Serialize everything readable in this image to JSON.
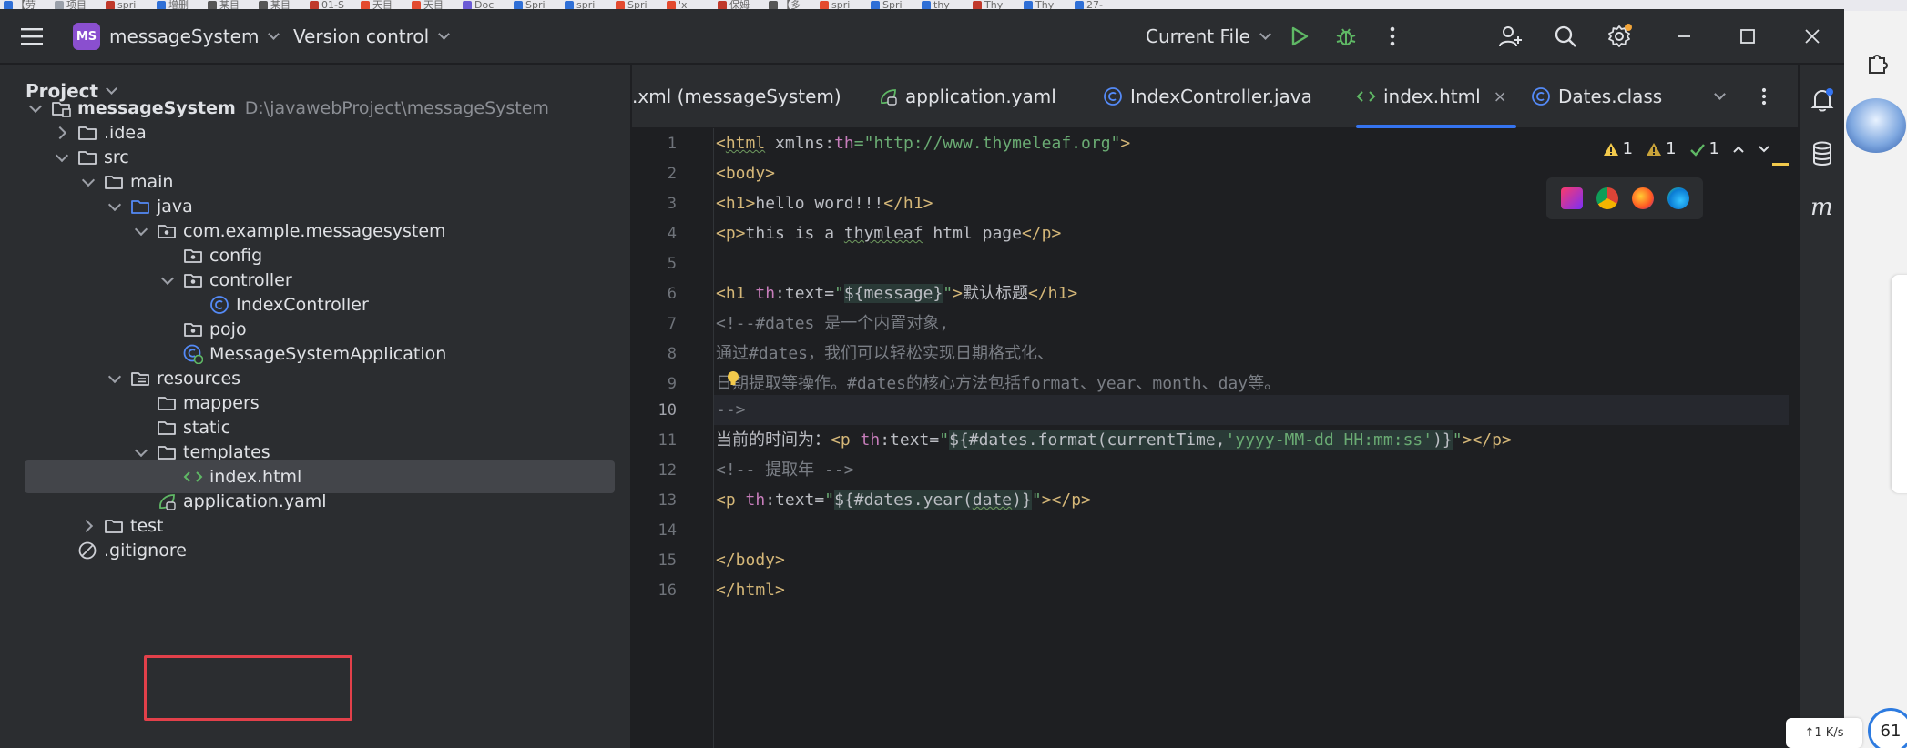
{
  "background_tabs": [
    {
      "label": "【劳",
      "color": "#2f6fd6"
    },
    {
      "label": "项目",
      "color": "#9aa0aa"
    },
    {
      "label": "spri",
      "color": "#c0392b"
    },
    {
      "label": "增删",
      "color": "#2f6fd6"
    },
    {
      "label": "某目",
      "color": "#555"
    },
    {
      "label": "某目",
      "color": "#555"
    },
    {
      "label": "01-S",
      "color": "#c0392b"
    },
    {
      "label": "天目",
      "color": "#e34a2f"
    },
    {
      "label": "天目",
      "color": "#e34a2f"
    },
    {
      "label": "Doc",
      "color": "#6b5bd6"
    },
    {
      "label": "Spri",
      "color": "#2f6fd6"
    },
    {
      "label": "spri",
      "color": "#2f6fd6"
    },
    {
      "label": "Spri",
      "color": "#e34a2f"
    },
    {
      "label": "'x",
      "color": "#e34a2f"
    },
    {
      "label": "保姆",
      "color": "#c0392b"
    },
    {
      "label": "【多",
      "color": "#555"
    },
    {
      "label": "spri",
      "color": "#e34a2f"
    },
    {
      "label": "Spri",
      "color": "#2f6fd6"
    },
    {
      "label": "thy",
      "color": "#2f6fd6"
    },
    {
      "label": "Thy",
      "color": "#c0392b"
    },
    {
      "label": "Thy",
      "color": "#2f6fd6"
    },
    {
      "label": "27-",
      "color": "#2f6fd6"
    }
  ],
  "titlebar": {
    "project_badge": "MS",
    "project_name": "messageSystem",
    "vcs": "Version control",
    "run_config": "Current File"
  },
  "project_panel": {
    "title": "Project",
    "tree": [
      {
        "label": "messageSystem",
        "path": "D:\\javawebProject\\messageSystem",
        "depth": 0,
        "arrow": "down",
        "icon": "module-folder-icon",
        "bold": true
      },
      {
        "label": ".idea",
        "depth": 1,
        "arrow": "right",
        "icon": "folder-icon"
      },
      {
        "label": "src",
        "depth": 1,
        "arrow": "down",
        "icon": "folder-icon"
      },
      {
        "label": "main",
        "depth": 2,
        "arrow": "down",
        "icon": "folder-icon"
      },
      {
        "label": "java",
        "depth": 3,
        "arrow": "down",
        "icon": "source-folder-icon"
      },
      {
        "label": "com.example.messagesystem",
        "depth": 4,
        "arrow": "down",
        "icon": "package-icon"
      },
      {
        "label": "config",
        "depth": 5,
        "arrow": "none",
        "icon": "package-icon"
      },
      {
        "label": "controller",
        "depth": 5,
        "arrow": "down",
        "icon": "package-icon"
      },
      {
        "label": "IndexController",
        "depth": 6,
        "arrow": "none",
        "icon": "class-icon"
      },
      {
        "label": "pojo",
        "depth": 5,
        "arrow": "none",
        "icon": "package-icon"
      },
      {
        "label": "MessageSystemApplication",
        "depth": 5,
        "arrow": "none",
        "icon": "spring-app-icon"
      },
      {
        "label": "resources",
        "depth": 3,
        "arrow": "down",
        "icon": "resources-folder-icon"
      },
      {
        "label": "mappers",
        "depth": 4,
        "arrow": "none",
        "icon": "folder-icon"
      },
      {
        "label": "static",
        "depth": 4,
        "arrow": "none",
        "icon": "folder-icon"
      },
      {
        "label": "templates",
        "depth": 4,
        "arrow": "down",
        "icon": "folder-icon"
      },
      {
        "label": "index.html",
        "depth": 5,
        "arrow": "none",
        "icon": "html-icon",
        "selected": true
      },
      {
        "label": "application.yaml",
        "depth": 4,
        "arrow": "none",
        "icon": "yaml-icon"
      },
      {
        "label": "test",
        "depth": 2,
        "arrow": "right",
        "icon": "folder-icon"
      },
      {
        "label": ".gitignore",
        "depth": 1,
        "arrow": "none",
        "icon": "ignore-icon"
      }
    ]
  },
  "editor": {
    "tabs": [
      {
        "label": ".xml (messageSystem)",
        "icon": "none"
      },
      {
        "label": "application.yaml",
        "icon": "yaml-icon"
      },
      {
        "label": "IndexController.java",
        "icon": "class-icon"
      },
      {
        "label": "index.html",
        "icon": "html-icon",
        "active": true,
        "close": "×"
      },
      {
        "label": "Dates.class",
        "icon": "class-icon"
      }
    ],
    "inspections": {
      "warn1": "1",
      "warn2": "1",
      "ok": "1"
    },
    "current_line": "10",
    "line_numbers": [
      "1",
      "2",
      "3",
      "4",
      "5",
      "6",
      "7",
      "8",
      "9",
      "10",
      "11",
      "12",
      "13",
      "14",
      "15",
      "16"
    ]
  },
  "colors": {
    "accent": "#3574f0",
    "highlight_box": "#e2404a",
    "tag": "#d5b778",
    "string": "#6aab73",
    "comment": "#7a7e85"
  }
}
